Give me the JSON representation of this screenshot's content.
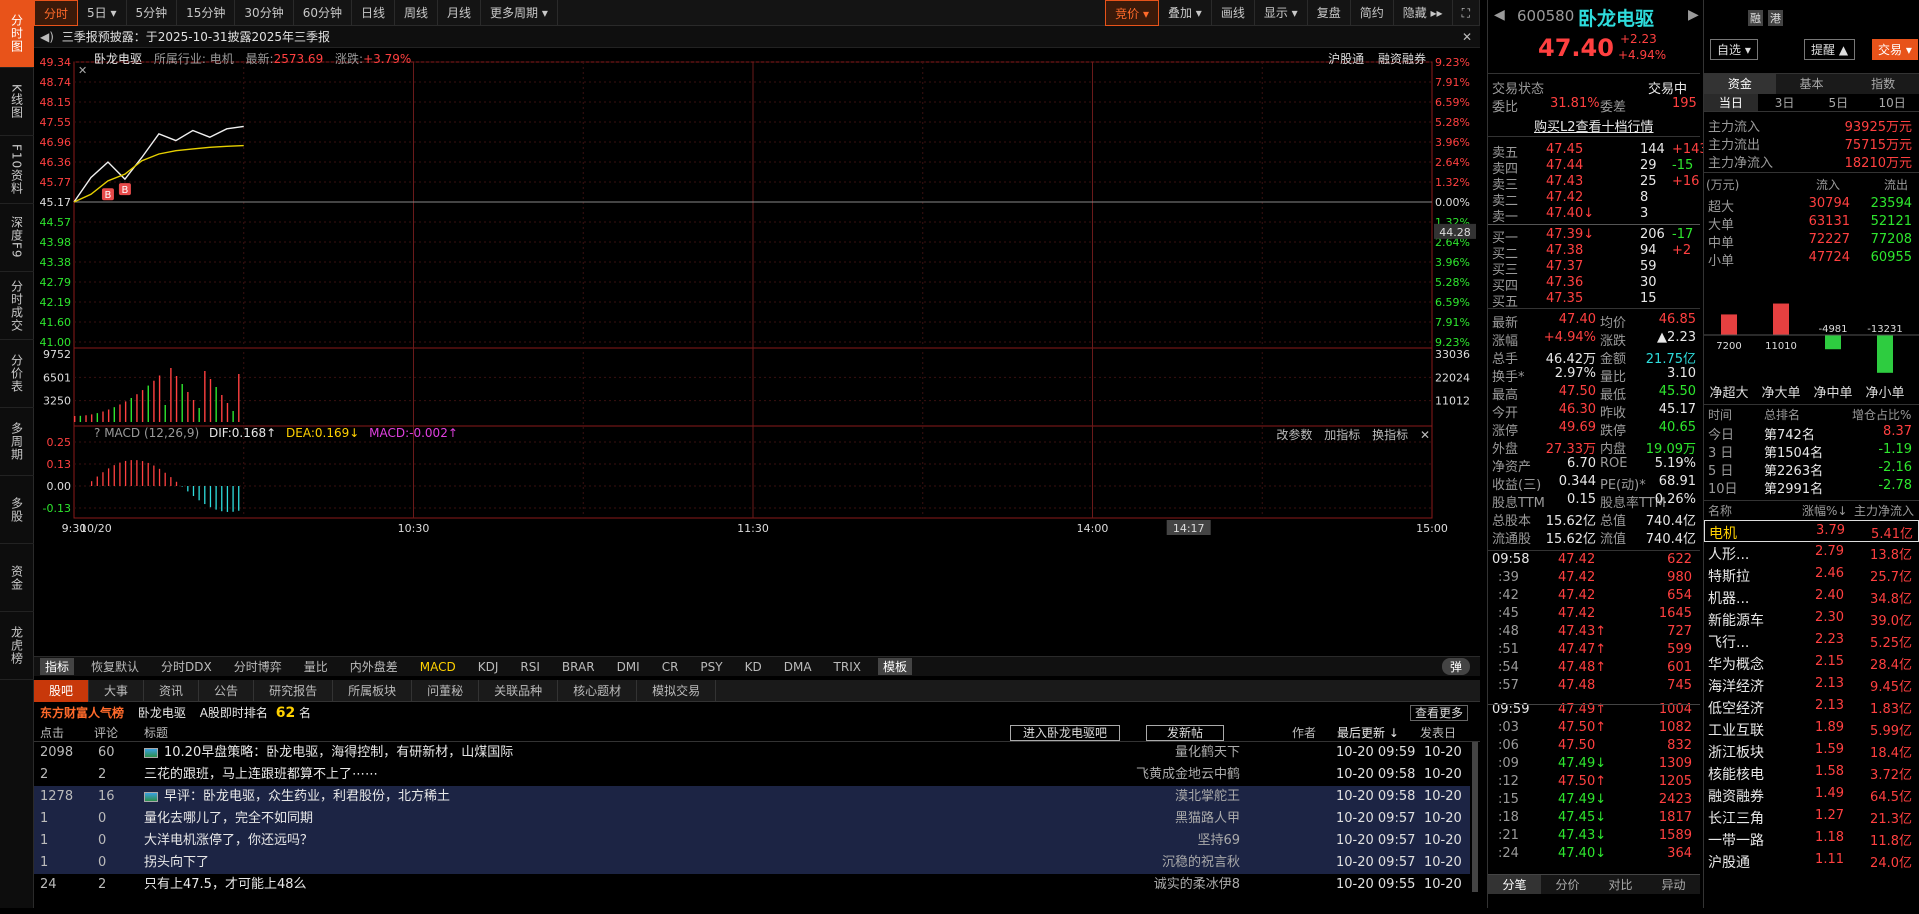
{
  "sidebar": [
    "分时图",
    "K线图",
    "F10资料",
    "深度F9",
    "分时成交",
    "分价表",
    "多周期",
    "多股",
    "资金",
    "龙虎榜"
  ],
  "topbar": {
    "items": [
      "分时",
      "5日 ▾",
      "5分钟",
      "15分钟",
      "30分钟",
      "60分钟",
      "日线",
      "周线",
      "月线",
      "更多周期 ▾"
    ],
    "right": [
      "竞价 ▾",
      "叠加 ▾",
      "画线",
      "显示 ▾",
      "复盘",
      "简约",
      "隐藏 ▸▸"
    ]
  },
  "notice": {
    "text": "三季报预披露：于2025-10-31披露2025年三季报"
  },
  "chart": {
    "stock": "卧龙电驱",
    "industry": "所属行业: 电机",
    "latest_label": "最新:",
    "latest": "2573.69",
    "change_label": "涨跌:",
    "change": "+3.79%",
    "tags": [
      "沪股通",
      "融资融券"
    ],
    "left_ticks": [
      "49.34",
      "48.74",
      "48.15",
      "47.55",
      "46.96",
      "46.36",
      "45.77",
      "45.17",
      "44.57",
      "43.98",
      "43.38",
      "42.79",
      "42.19",
      "41.60",
      "41.00"
    ],
    "right_ticks": [
      "9.23%",
      "7.91%",
      "6.59%",
      "5.28%",
      "3.96%",
      "2.64%",
      "1.32%",
      "0.00%",
      "1.32%",
      "2.64%",
      "3.96%",
      "5.28%",
      "6.59%",
      "7.91%",
      "9.23%"
    ],
    "price_tag": "44.28",
    "vol_left": [
      "9752",
      "6501",
      "3250"
    ],
    "vol_right": [
      "33036",
      "22024",
      "11012"
    ],
    "macd_label": "MACD (12,26,9)",
    "dif": "DIF:0.168↑",
    "dea": "DEA:0.169↓",
    "macd": "MACD:-0.002↑",
    "macd_btns": [
      "改参数",
      "加指标",
      "换指标"
    ],
    "macd_ticks": [
      "0.25",
      "0.13",
      "0.00",
      "-0.13"
    ],
    "x_ticks": [
      "10/20",
      "9:30",
      "10:30",
      "11:30",
      "14:00",
      "14:17",
      "15:00"
    ]
  },
  "indicators": [
    "指标",
    "恢复默认",
    "分时DDX",
    "分时博弈",
    "量比",
    "内外盘差",
    "MACD",
    "KDJ",
    "RSI",
    "BRAR",
    "DMI",
    "CR",
    "PSY",
    "KD",
    "DMA",
    "TRIX",
    "模板"
  ],
  "indicator_toggle": "弹",
  "news": {
    "tabs": [
      "股吧",
      "大事",
      "资讯",
      "公告",
      "研究报告",
      "所属板块",
      "问董秘",
      "关联品种",
      "核心题材",
      "模拟交易"
    ],
    "brand": "东方财富人气榜",
    "stock": "卧龙电驱",
    "rank_label": "A股即时排名",
    "rank": "62",
    "rank_unit": "名",
    "more": "查看更多",
    "headers": [
      "点击",
      "评论",
      "标题",
      "作者",
      "最后更新 ↓",
      "发表日"
    ],
    "btn1": "进入卧龙电驱吧",
    "btn2": "发新帖",
    "rows": [
      {
        "c": "2098",
        "r": "60",
        "t": "10.20早盘策略：卧龙电驱，海得控制，有研新材，山煤国际",
        "a": "量化鹤天下",
        "u": "10-20  09:59",
        "d": "10-20",
        "img": true
      },
      {
        "c": "2",
        "r": "2",
        "t": "三花的跟班，马上连跟班都算不上了⋯⋯",
        "a": "飞黄成金地云中鹤",
        "u": "10-20  09:58",
        "d": "10-20",
        "img": false
      },
      {
        "c": "1278",
        "r": "16",
        "t": "早评：卧龙电驱，众生药业，利君股份，北方稀土",
        "a": "漠北掌舵王",
        "u": "10-20  09:58",
        "d": "10-20",
        "img": true
      },
      {
        "c": "1",
        "r": "0",
        "t": "量化去哪儿了，完全不如同期",
        "a": "黑猫路人甲",
        "u": "10-20  09:57",
        "d": "10-20",
        "img": false
      },
      {
        "c": "1",
        "r": "0",
        "t": "大洋电机涨停了，你还远吗？",
        "a": "坚持69",
        "u": "10-20  09:57",
        "d": "10-20",
        "img": false
      },
      {
        "c": "1",
        "r": "0",
        "t": "拐头向下了",
        "a": "沉稳的祝言秋",
        "u": "10-20  09:57",
        "d": "10-20",
        "img": false
      },
      {
        "c": "24",
        "r": "2",
        "t": "只有上47.5，才可能上48么",
        "a": "诚实的柔冰伊8",
        "u": "10-20  09:55",
        "d": "10-20",
        "img": false
      }
    ]
  },
  "quote": {
    "code": "600580",
    "name": "卧龙电驱",
    "price": "47.40",
    "chg": "+2.23",
    "pct": "+4.94%",
    "btns": [
      "融",
      "港"
    ],
    "zixuan": "自选 ▾",
    "remind": "提醒 ▲",
    "trade": "交易 ▾",
    "status_label": "交易状态",
    "status": "交易中",
    "weibi_label": "委比",
    "weibi": "31.81%",
    "weicha_label": "委差",
    "weicha": "195",
    "l2": "购买L2查看十档行情",
    "sells": [
      {
        "l": "卖五",
        "p": "47.45",
        "v": "144",
        "d": "+143"
      },
      {
        "l": "卖四",
        "p": "47.44",
        "v": "29",
        "d": "-15"
      },
      {
        "l": "卖三",
        "p": "47.43",
        "v": "25",
        "d": "+16"
      },
      {
        "l": "卖二",
        "p": "47.42",
        "v": "8",
        "d": ""
      },
      {
        "l": "卖一",
        "p": "47.40↓",
        "v": "3",
        "d": ""
      }
    ],
    "buys": [
      {
        "l": "买一",
        "p": "47.39↓",
        "v": "206",
        "d": "-17"
      },
      {
        "l": "买二",
        "p": "47.38",
        "v": "94",
        "d": "+2"
      },
      {
        "l": "买三",
        "p": "47.37",
        "v": "59",
        "d": ""
      },
      {
        "l": "买四",
        "p": "47.36",
        "v": "30",
        "d": ""
      },
      {
        "l": "买五",
        "p": "47.35",
        "v": "15",
        "d": ""
      }
    ],
    "stats": [
      [
        "最新",
        "47.40",
        "均价",
        "46.85"
      ],
      [
        "涨幅",
        "+4.94%",
        "涨跌",
        "▲2.23"
      ],
      [
        "总手",
        "46.42万",
        "金额",
        "21.75亿"
      ],
      [
        "换手*",
        "2.97%",
        "量比",
        "3.10"
      ],
      [
        "最高",
        "47.50",
        "最低",
        "45.50"
      ],
      [
        "今开",
        "46.30",
        "昨收",
        "45.17"
      ],
      [
        "涨停",
        "49.69",
        "跌停",
        "40.65"
      ],
      [
        "外盘",
        "27.33万",
        "内盘",
        "19.09万"
      ],
      [
        "净资产",
        "6.70",
        "ROE",
        "5.19%"
      ],
      [
        "收益(三)",
        "0.344",
        "PE(动)*",
        "68.91"
      ],
      [
        "股息TTM",
        "0.15",
        "股息率TTM",
        "0.26%"
      ],
      [
        "总股本",
        "15.62亿",
        "总值",
        "740.4亿"
      ],
      [
        "流通股",
        "15.62亿",
        "流值",
        "740.4亿"
      ]
    ],
    "ticks": [
      {
        "t": "09:58",
        "p": "47.42",
        "v": "622"
      },
      {
        "t": ":39",
        "p": "47.42",
        "v": "980"
      },
      {
        "t": ":42",
        "p": "47.42",
        "v": "654"
      },
      {
        "t": ":45",
        "p": "47.42",
        "v": "1645"
      },
      {
        "t": ":48",
        "p": "47.43↑",
        "v": "727"
      },
      {
        "t": ":51",
        "p": "47.47↑",
        "v": "599"
      },
      {
        "t": ":54",
        "p": "47.48↑",
        "v": "601"
      },
      {
        "t": ":57",
        "p": "47.48",
        "v": "745"
      },
      {
        "t": "09:59",
        "p": "47.49↑",
        "v": "1004"
      },
      {
        "t": ":03",
        "p": "47.50↑",
        "v": "1082"
      },
      {
        "t": ":06",
        "p": "47.50",
        "v": "832"
      },
      {
        "t": ":09",
        "p": "47.49↓",
        "v": "1309"
      },
      {
        "t": ":12",
        "p": "47.50↑",
        "v": "1205"
      },
      {
        "t": ":15",
        "p": "47.49↓",
        "v": "2423"
      },
      {
        "t": ":18",
        "p": "47.45↓",
        "v": "1817"
      },
      {
        "t": ":21",
        "p": "47.43↓",
        "v": "1589"
      },
      {
        "t": ":24",
        "p": "47.40↓",
        "v": "364"
      }
    ],
    "bottom_tabs": [
      "分笔",
      "分价",
      "对比",
      "异动"
    ]
  },
  "fund": {
    "tabs": [
      "资金",
      "基本",
      "指数"
    ],
    "periods": [
      "当日",
      "3日",
      "5日",
      "10日"
    ],
    "flow": [
      [
        "主力流入",
        "93925万元"
      ],
      [
        "主力流出",
        "75715万元"
      ],
      [
        "主力净流入",
        "18210万元"
      ]
    ],
    "unit": "(万元)",
    "in": "流入",
    "out": "流出",
    "sizes": [
      [
        "超大",
        "30794",
        "23594"
      ],
      [
        "大单",
        "63131",
        "52121"
      ],
      [
        "中单",
        "72227",
        "77208"
      ],
      [
        "小单",
        "47724",
        "60955"
      ]
    ],
    "bars": [
      {
        "label": "净超大",
        "v": 7200
      },
      {
        "label": "净大单",
        "v": 11010
      },
      {
        "label": "净中单",
        "v": -4981
      },
      {
        "label": "净小单",
        "v": -13231
      }
    ],
    "rank_headers": [
      "时间",
      "总排名",
      "增仓占比%"
    ],
    "ranks": [
      [
        "今日",
        "第742名",
        "8.37"
      ],
      [
        "3 日",
        "第1504名",
        "-1.19"
      ],
      [
        "5 日",
        "第2263名",
        "-2.16"
      ],
      [
        "10日",
        "第2991名",
        "-2.78"
      ]
    ],
    "sector_headers": [
      "名称",
      "涨幅%↓",
      "主力净流入"
    ],
    "sectors": [
      [
        "电机",
        "3.79",
        "5.41亿"
      ],
      [
        "人形...",
        "2.79",
        "13.8亿"
      ],
      [
        "特斯拉",
        "2.46",
        "25.7亿"
      ],
      [
        "机器...",
        "2.40",
        "34.8亿"
      ],
      [
        "新能源车",
        "2.30",
        "39.0亿"
      ],
      [
        "飞行...",
        "2.23",
        "5.25亿"
      ],
      [
        "华为概念",
        "2.15",
        "28.4亿"
      ],
      [
        "海洋经济",
        "2.13",
        "9.45亿"
      ],
      [
        "低空经济",
        "2.13",
        "1.83亿"
      ],
      [
        "工业互联",
        "1.89",
        "5.99亿"
      ],
      [
        "浙江板块",
        "1.59",
        "18.4亿"
      ],
      [
        "核能核电",
        "1.58",
        "3.72亿"
      ],
      [
        "融资融券",
        "1.49",
        "64.5亿"
      ],
      [
        "长江三角",
        "1.27",
        "21.3亿"
      ],
      [
        "一带一路",
        "1.18",
        "11.8亿"
      ],
      [
        "沪股通",
        "1.11",
        "24.0亿"
      ]
    ]
  },
  "chart_data": {
    "type": "line",
    "title": "",
    "x": [
      "9:30",
      "9:33",
      "9:36",
      "9:39",
      "9:42",
      "9:45",
      "9:48",
      "9:51",
      "9:54",
      "9:57",
      "9:59"
    ],
    "series": [
      {
        "values": [
          45.17,
          45.9,
          46.36,
          45.85,
          46.5,
          47.2,
          47.0,
          47.3,
          47.1,
          47.35,
          47.42
        ]
      },
      {
        "values": [
          45.17,
          45.4,
          45.8,
          46.0,
          46.4,
          46.6,
          46.7,
          46.75,
          46.8,
          46.83,
          46.85
        ]
      }
    ],
    "ylim": [
      41.0,
      49.34
    ]
  }
}
